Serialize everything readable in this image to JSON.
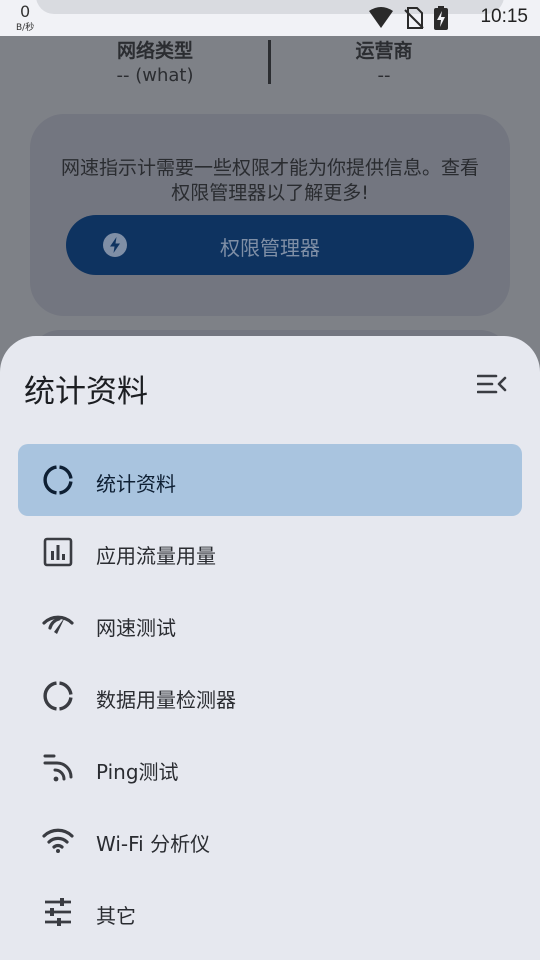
{
  "status_bar": {
    "speed_value": "0",
    "speed_unit": "B/秒",
    "time": "10:15"
  },
  "network_info": {
    "type_label": "网络类型",
    "type_value": "-- (what)",
    "carrier_label": "运营商",
    "carrier_value": "--"
  },
  "permission_card": {
    "message": "网速指示计需要一些权限才能为你提供信息。查看权限管理器以了解更多!",
    "button_label": "权限管理器"
  },
  "sheet": {
    "title": "统计资料",
    "items": [
      {
        "label": "统计资料",
        "icon": "donut-chart-icon",
        "selected": true
      },
      {
        "label": "应用流量用量",
        "icon": "bar-chart-icon",
        "selected": false
      },
      {
        "label": "网速测试",
        "icon": "speedometer-icon",
        "selected": false
      },
      {
        "label": "数据用量检测器",
        "icon": "donut-outline-icon",
        "selected": false
      },
      {
        "label": "Ping测试",
        "icon": "ping-signal-icon",
        "selected": false
      },
      {
        "label": "Wi-Fi 分析仪",
        "icon": "wifi-icon",
        "selected": false
      },
      {
        "label": "其它",
        "icon": "tune-sliders-icon",
        "selected": false
      }
    ]
  },
  "colors": {
    "sheet_bg": "#e6e8ef",
    "selected_bg": "#a9c4df",
    "button_bg": "#0e3360",
    "icon_color": "#3a3c42"
  }
}
